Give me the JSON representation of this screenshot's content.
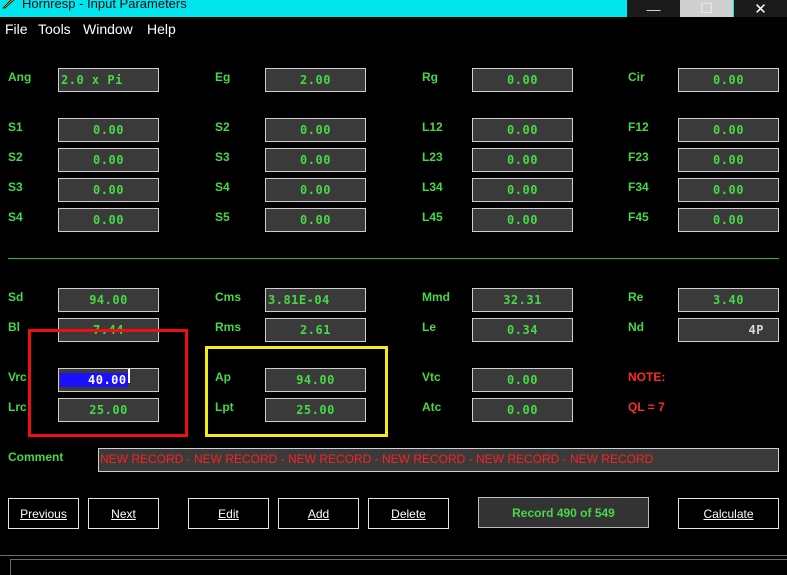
{
  "window": {
    "title": "Hornresp - Input Parameters",
    "minimize_glyph": "—",
    "maximize_glyph": "☐",
    "close_glyph": "✕"
  },
  "menu": [
    "File",
    "Tools",
    "Window",
    "Help"
  ],
  "top_rows": [
    [
      {
        "label": "Ang",
        "value": "2.0 x Pi"
      },
      {
        "label": "Eg",
        "value": "2.00"
      },
      {
        "label": "Rg",
        "value": "0.00"
      },
      {
        "label": "Cir",
        "value": "0.00"
      }
    ],
    [
      {
        "label": "S1",
        "value": "0.00"
      },
      {
        "label": "S2",
        "value": "0.00"
      },
      {
        "label": "L12",
        "value": "0.00"
      },
      {
        "label": "F12",
        "value": "0.00"
      }
    ],
    [
      {
        "label": "S2",
        "value": "0.00"
      },
      {
        "label": "S3",
        "value": "0.00"
      },
      {
        "label": "L23",
        "value": "0.00"
      },
      {
        "label": "F23",
        "value": "0.00"
      }
    ],
    [
      {
        "label": "S3",
        "value": "0.00"
      },
      {
        "label": "S4",
        "value": "0.00"
      },
      {
        "label": "L34",
        "value": "0.00"
      },
      {
        "label": "F34",
        "value": "0.00"
      }
    ],
    [
      {
        "label": "S4",
        "value": "0.00"
      },
      {
        "label": "S5",
        "value": "0.00"
      },
      {
        "label": "L45",
        "value": "0.00"
      },
      {
        "label": "F45",
        "value": "0.00"
      }
    ]
  ],
  "driver_rows": [
    [
      {
        "label": "Sd",
        "value": "94.00"
      },
      {
        "label": "Cms",
        "value": "3.81E-04"
      },
      {
        "label": "Mmd",
        "value": "32.31"
      },
      {
        "label": "Re",
        "value": "3.40"
      }
    ],
    [
      {
        "label": "Bl",
        "value": "7.44"
      },
      {
        "label": "Rms",
        "value": "2.61"
      },
      {
        "label": "Le",
        "value": "0.34"
      },
      {
        "label": "Nd",
        "value": "4P"
      }
    ]
  ],
  "chamber_rows": [
    [
      {
        "label": "Vrc",
        "value": "40.00"
      },
      {
        "label": "Ap",
        "value": "94.00"
      },
      {
        "label": "Vtc",
        "value": "0.00"
      },
      {
        "label": "NOTE:"
      }
    ],
    [
      {
        "label": "Lrc",
        "value": "25.00"
      },
      {
        "label": "Lpt",
        "value": "25.00"
      },
      {
        "label": "Atc",
        "value": "0.00"
      },
      {
        "label": "QL = 7"
      }
    ]
  ],
  "comment": {
    "label": "Comment",
    "value": "NEW RECORD - NEW RECORD - NEW RECORD - NEW RECORD - NEW RECORD - NEW RECORD"
  },
  "buttons": {
    "previous": "Previous",
    "next": "Next",
    "edit": "Edit",
    "add": "Add",
    "delete": "Delete",
    "record": "Record 490 of 549",
    "calculate": "Calculate"
  },
  "colors": {
    "label_green": "#46d846",
    "note_red": "#ff2a2a",
    "titlebar_cyan": "#00e5ee",
    "annotation_red": "#ee1010",
    "annotation_yellow": "#f2ef10",
    "selection_blue": "#1a10ff"
  },
  "icons": {
    "app": "horn-app-icon"
  }
}
